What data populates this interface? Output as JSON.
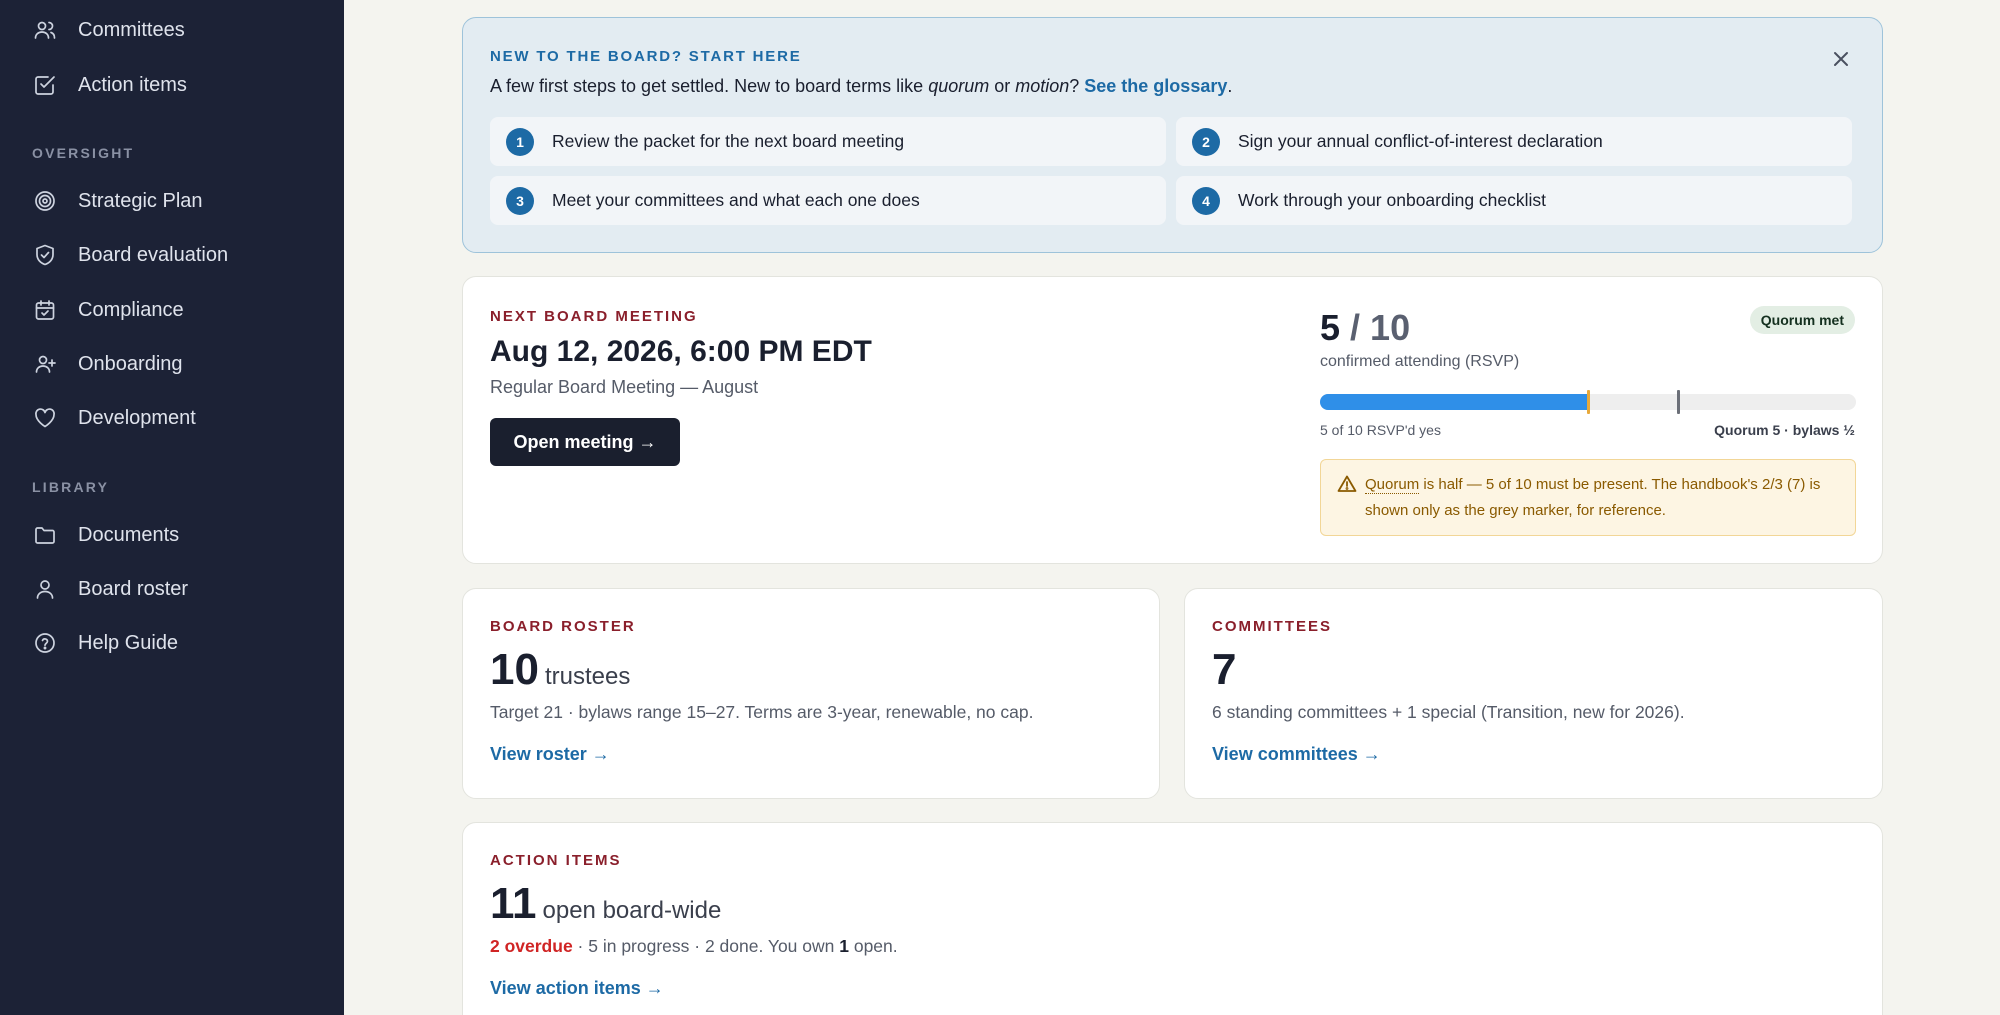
{
  "sidebar": {
    "items_top": [
      {
        "label": "Committees",
        "icon": "users-icon"
      },
      {
        "label": "Action items",
        "icon": "checkbox-icon"
      }
    ],
    "oversight": {
      "title": "OVERSIGHT",
      "items": [
        {
          "label": "Strategic Plan",
          "icon": "target-icon"
        },
        {
          "label": "Board evaluation",
          "icon": "shield-check-icon"
        },
        {
          "label": "Compliance",
          "icon": "calendar-check-icon"
        },
        {
          "label": "Onboarding",
          "icon": "user-plus-icon"
        },
        {
          "label": "Development",
          "icon": "heart-icon"
        }
      ]
    },
    "library": {
      "title": "LIBRARY",
      "items": [
        {
          "label": "Documents",
          "icon": "folder-icon"
        },
        {
          "label": "Board roster",
          "icon": "user-icon"
        },
        {
          "label": "Help Guide",
          "icon": "help-circle-icon"
        }
      ]
    }
  },
  "welcome": {
    "title": "NEW TO THE BOARD? START HERE",
    "desc_pre": "A few first steps to get settled. New to board terms like ",
    "term1": "quorum",
    "desc_or": " or ",
    "term2": "motion",
    "desc_q": "? ",
    "link": "See the glossary",
    "desc_end": ".",
    "steps": [
      {
        "num": "1",
        "label": "Review the packet for the next board meeting"
      },
      {
        "num": "2",
        "label": "Sign your annual conflict-of-interest declaration"
      },
      {
        "num": "3",
        "label": "Meet your committees and what each one does"
      },
      {
        "num": "4",
        "label": "Work through your onboarding checklist"
      }
    ]
  },
  "meeting": {
    "eyebrow": "NEXT BOARD MEETING",
    "date": "Aug 12, 2026, 6:00 PM EDT",
    "name": "Regular Board Meeting — August",
    "button": "Open meeting →",
    "rsvp_count": "5",
    "rsvp_sep": " / ",
    "rsvp_total": "10",
    "rsvp_sub": "confirmed attending (RSVP)",
    "badge": "Quorum met",
    "progress_fraction": 0.5,
    "quorum_marker_fraction": 0.5,
    "handbook_marker_fraction": 0.667,
    "quorum_marker_color": "#e8a93a",
    "handbook_marker_color": "#6b6f78",
    "bar_left": "5 of 10 RSVP'd yes",
    "bar_right": "Quorum 5 · bylaws ½",
    "warn_term": "Quorum",
    "warn_text": " is half — 5 of 10 must be present. The handbook's 2/3 (7) is shown only as the grey marker, for reference."
  },
  "roster": {
    "eyebrow": "BOARD ROSTER",
    "count": "10",
    "unit": "trustees",
    "desc": "Target 21 · bylaws range 15–27. Terms are 3-year, renewable, no cap.",
    "link": "View roster →"
  },
  "committees": {
    "eyebrow": "COMMITTEES",
    "count": "7",
    "desc": "6 standing committees + 1 special (Transition, new for 2026).",
    "link": "View committees →"
  },
  "actions": {
    "eyebrow": "ACTION ITEMS",
    "count": "11",
    "unit": "open board-wide",
    "overdue": "2 overdue",
    "mid": " · 5 in progress · 2 done. You own ",
    "own": "1",
    "end": " open.",
    "link": "View action items →"
  }
}
